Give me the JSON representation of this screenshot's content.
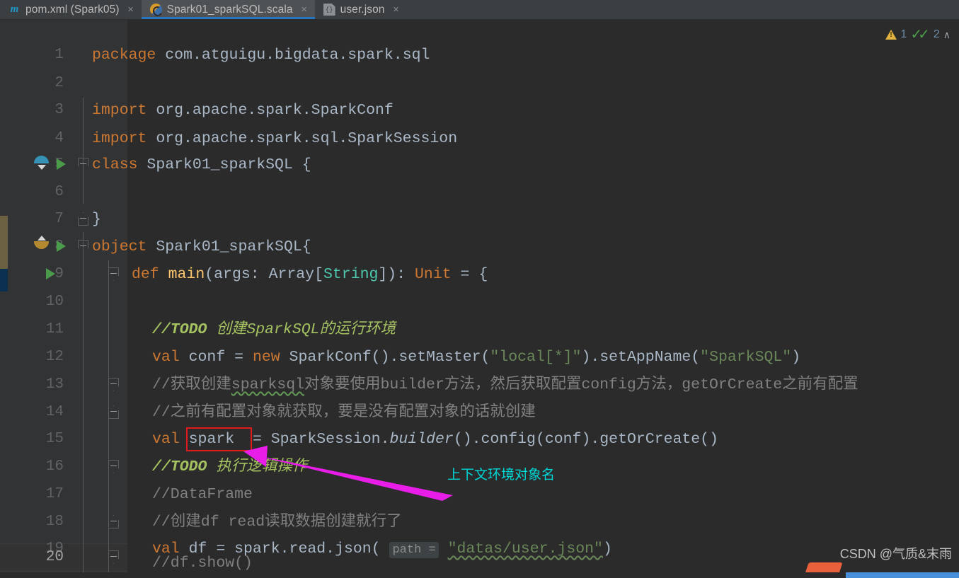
{
  "window": {
    "theme_bg": "#2b2b2b",
    "accent": "#2675bf"
  },
  "tabs": [
    {
      "label": "pom.xml (Spark05)",
      "icon": "maven-icon",
      "close": "×",
      "active": false
    },
    {
      "label": "Spark01_sparkSQL.scala",
      "icon": "scala-icon",
      "close": "×",
      "active": true
    },
    {
      "label": "user.json",
      "icon": "json-icon",
      "close": "×",
      "active": false
    }
  ],
  "inspections": {
    "warning_icon": "warning-triangle-icon",
    "warning_count": "1",
    "ok_icon": "double-check-icon",
    "ok_count": "2",
    "collapse_icon": "∧"
  },
  "editor": {
    "line_numbers": [
      "1",
      "2",
      "3",
      "4",
      "5",
      "6",
      "7",
      "8",
      "9",
      "10",
      "11",
      "12",
      "13",
      "14",
      "15",
      "16",
      "17",
      "18",
      "19",
      "20"
    ],
    "current_line": "20",
    "lines": [
      {
        "n": "1",
        "text": "package com.atguigu.bigdata.spark.sql"
      },
      {
        "n": "2",
        "text": ""
      },
      {
        "n": "3",
        "text": "import org.apache.spark.SparkConf"
      },
      {
        "n": "4",
        "text": "import org.apache.spark.sql.SparkSession"
      },
      {
        "n": "5",
        "text": "class Spark01_sparkSQL {"
      },
      {
        "n": "6",
        "text": ""
      },
      {
        "n": "7",
        "text": "}"
      },
      {
        "n": "8",
        "text": "object Spark01_sparkSQL{"
      },
      {
        "n": "9",
        "text": "    def main(args: Array[String]): Unit = {"
      },
      {
        "n": "10",
        "text": ""
      },
      {
        "n": "11",
        "text": "        //TODO 创建SparkSQL的运行环境"
      },
      {
        "n": "12",
        "text": "        val conf = new SparkConf().setMaster(\"local[*]\").setAppName(\"SparkSQL\")"
      },
      {
        "n": "13",
        "text": "        //获取创建sparksql对象要使用builder方法，然后获取配置config方法，getOrCreate之前有配置"
      },
      {
        "n": "14",
        "text": "        //之前有配置对象就获取，要是没有配置对象的话就创建"
      },
      {
        "n": "15",
        "text": "        val spark = SparkSession.builder().config(conf).getOrCreate()"
      },
      {
        "n": "16",
        "text": "        //TODO 执行逻辑操作"
      },
      {
        "n": "17",
        "text": "        //DataFrame"
      },
      {
        "n": "18",
        "text": "        //创建df read读取数据创建就行了"
      },
      {
        "n": "19",
        "text": "        val df = spark.read.json( path = \"datas/user.json\")"
      },
      {
        "n": "20",
        "text": "        //df.show()"
      }
    ],
    "tokens": {
      "kw_package": "package",
      "pkg_name": "com.atguigu.bigdata.spark.sql",
      "kw_import": "import",
      "import1": "org.apache.spark.SparkConf",
      "import2": "org.apache.spark.sql.SparkSession",
      "kw_class": "class",
      "class_name": "Spark01_sparkSQL {",
      "brace_close": "}",
      "kw_object": "object",
      "object_name": "Spark01_sparkSQL{",
      "kw_def": "def",
      "fn_main": "main",
      "main_sig_a": "(args: ",
      "main_type": "Array[",
      "main_string": "String",
      "main_sig_b": "]): ",
      "kw_unit": "Unit",
      "main_sig_c": " = {",
      "todo_marker": "//TODO",
      "todo_text_11": "创建SparkSQL的运行环境",
      "todo_text_16": "执行逻辑操作",
      "kw_val": "val",
      "name_conf": " conf = ",
      "kw_new": "new",
      "conf_a": " SparkConf().setMaster(",
      "str_local": "\"local[*]\"",
      "conf_b": ").setAppName(",
      "str_sparksql": "\"SparkSQL\"",
      "conf_c": ")",
      "cmt13": "//获取创建",
      "cmt13_sq": "sparksql",
      "cmt13_b": "对象要使用builder方法，然后获取配置config方法，getOrCreate之前有配置",
      "cmt14": "//之前有配置对象就获取，要是没有配置对象的话就创建",
      "val15_name": "spark",
      "val15_rest": "= SparkSession.",
      "val15_builder": "builder",
      "val15_tail": "().config(conf).getOrCreate()",
      "cmt17": "//DataFrame",
      "cmt18": "//创建df read读取数据创建就行了",
      "val19_a": " df = spark.read.json( ",
      "val19_hint": "path =",
      "val19_str": "\"datas/user.json\"",
      "val19_b": ")",
      "cmt20": "//df.show()"
    }
  },
  "gutter": {
    "line5": {
      "marker": "class-marker-icon",
      "run": "run-gutter-icon",
      "fold": "fold-start-icon"
    },
    "line7": {
      "fold": "fold-end-icon"
    },
    "line8": {
      "marker": "object-marker-icon",
      "run": "run-gutter-icon",
      "fold": "fold-start-icon"
    },
    "line9": {
      "run": "run-gutter-icon",
      "fold": "fold-start-icon"
    }
  },
  "annotation": {
    "text": "上下文环境对象名",
    "text_color": "#00d7d7",
    "arrow_color": "#e81ee8",
    "highlight_box_color": "#e01b1b",
    "highlight_target": "spark"
  },
  "watermark": {
    "text": "CSDN @气质&末雨"
  }
}
